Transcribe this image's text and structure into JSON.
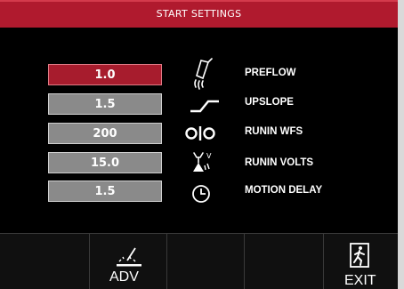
{
  "title": "START SETTINGS",
  "params": [
    {
      "value": "1.0",
      "label": "PREFLOW",
      "icon": "preflow-nozzle-icon",
      "selected": true
    },
    {
      "value": "1.5",
      "label": "UPSLOPE",
      "icon": "upslope-icon",
      "selected": false
    },
    {
      "value": "200",
      "label": "RUNIN WFS",
      "icon": "wire-feed-rolls-icon",
      "selected": false
    },
    {
      "value": "15.0",
      "label": "RUNIN VOLTS",
      "icon": "arc-voltage-icon",
      "selected": false
    },
    {
      "value": "1.5",
      "label": "MOTION DELAY",
      "icon": "clock-icon",
      "selected": false
    }
  ],
  "bottom_bar": {
    "adv_label": "ADV",
    "exit_label": "EXIT"
  },
  "colors": {
    "title_bar": "#b01a2e",
    "selected_value": "#a71c2d",
    "value_box": "#8a8a8a",
    "background": "#000000"
  }
}
